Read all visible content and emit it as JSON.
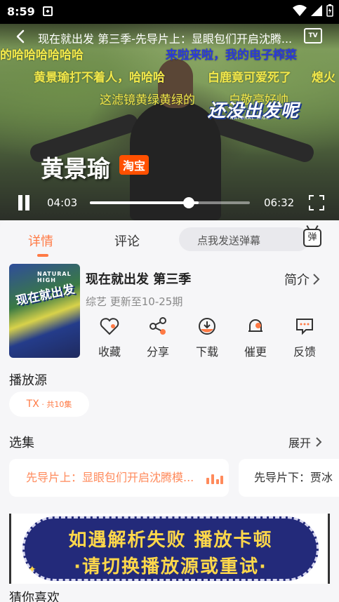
{
  "status_bar": {
    "time": "8:59"
  },
  "player": {
    "title": "现在就出发 第三季-先导片上：显眼包们开启沈腾...",
    "tv_label": "TV",
    "danmaku": [
      "的哈哈哈哈哈哈",
      "来啦来啦，我的电子榨菜",
      "黄景瑜打不着人，哈哈哈",
      "白鹿竟可爱死了",
      "熄火",
      "这滤镜黄绿黄绿的",
      "白敬亭好帅"
    ],
    "overlay_logo": "还没出发呢",
    "overlay_logo_sub": "NATURAL HIGH",
    "name_plate": "黄景瑜",
    "sponsor": "淘宝",
    "current_time": "04:03",
    "total_time": "06:32",
    "progress": 0.62,
    "buffered": 0.68
  },
  "tabs": {
    "detail": "详情",
    "comments": "评论"
  },
  "danmu_input": {
    "placeholder": "点我发送弹幕",
    "icon_label": "弹"
  },
  "show": {
    "poster_logo": "现在就出发",
    "poster_top": "NATURAL HIGH",
    "title": "现在就出发 第三季",
    "meta": "综艺 更新至10-25期",
    "intro_label": "简介"
  },
  "actions": [
    {
      "label": "收藏",
      "icon": "heart-icon"
    },
    {
      "label": "分享",
      "icon": "share-icon"
    },
    {
      "label": "下载",
      "icon": "download-icon"
    },
    {
      "label": "催更",
      "icon": "bell-icon"
    },
    {
      "label": "反馈",
      "icon": "feedback-icon"
    }
  ],
  "sources": {
    "title": "播放源",
    "chip_name": "TX",
    "chip_count": " · 共10集"
  },
  "episodes": {
    "title": "选集",
    "expand_label": "展开",
    "items": [
      "先导片上：显眼包们开启沈腾模...",
      "先导片下：贾冰"
    ]
  },
  "banner": {
    "line1": "如遇解析失败 播放卡顿",
    "line2": "·请切换播放源或重试·"
  },
  "recommend_title": "猜你喜欢",
  "colors": {
    "accent": "#ff7a45",
    "banner_bg": "#232a7a",
    "banner_text": "#ffd84a"
  }
}
